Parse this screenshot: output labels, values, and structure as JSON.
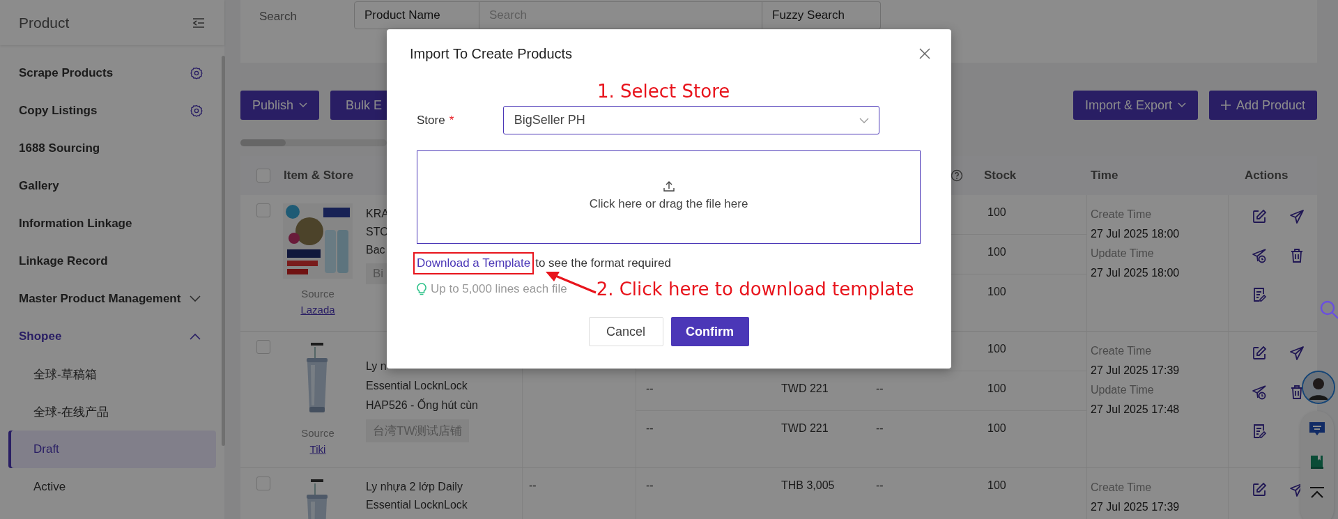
{
  "sidebar": {
    "title": "Product",
    "items": [
      {
        "label": "Scrape Products",
        "kind": "setting",
        "selected": false
      },
      {
        "label": "Copy Listings",
        "kind": "setting",
        "selected": false
      },
      {
        "label": "1688 Sourcing",
        "kind": "link",
        "selected": false
      },
      {
        "label": "Gallery",
        "kind": "link",
        "selected": false
      },
      {
        "label": "Information Linkage",
        "kind": "link",
        "selected": false
      },
      {
        "label": "Linkage Record",
        "kind": "link",
        "selected": false
      },
      {
        "label": "Master Product Management",
        "kind": "group",
        "selected": false,
        "expanded": false
      },
      {
        "label": "Shopee",
        "kind": "group",
        "selected": true,
        "expanded": true,
        "children": [
          {
            "label": "全球-草稿箱",
            "selected": false
          },
          {
            "label": "全球-在线产品",
            "selected": false
          },
          {
            "label": "Draft",
            "selected": true
          },
          {
            "label": "Active",
            "selected": false
          }
        ]
      }
    ]
  },
  "search": {
    "label": "Search",
    "field": "Product Name",
    "placeholder": "Search",
    "mode": "Fuzzy Search"
  },
  "toolbar": {
    "left": [
      {
        "label": "Publish",
        "kind": "menu"
      },
      {
        "label": "Bulk E",
        "kind": "plain"
      }
    ],
    "right": [
      {
        "label": "Import & Export",
        "kind": "menu"
      },
      {
        "label": "Add Product",
        "kind": "add"
      }
    ]
  },
  "table": {
    "select_all": {
      "checked": false
    },
    "headers": {
      "item": "Item & Store",
      "stock": "Stock",
      "time": "Time",
      "actions": "Actions"
    },
    "rows": [
      {
        "checked": false,
        "image": {
          "kind": "picture"
        },
        "title_lines": [
          "KRA",
          "STO",
          "Bac"
        ],
        "tag": "Bi",
        "source_label": "Source",
        "source": "Lazada",
        "variants": [
          {
            "stock": "100"
          },
          {
            "stock": "100"
          },
          {
            "stock": "100"
          }
        ],
        "times": [
          {
            "label": "Create Time",
            "value": "27 Jul 2025 18:00"
          },
          {
            "label": "Update Time",
            "value": "27 Jul 2025 18:00"
          }
        ],
        "actions": [
          {
            "kind": "edit"
          },
          {
            "kind": "publish"
          },
          {
            "kind": "schedule"
          },
          {
            "kind": "delete"
          },
          {
            "kind": "notes"
          }
        ]
      },
      {
        "checked": false,
        "image": {
          "kind": "picture"
        },
        "title_lines": [
          "Ly n",
          "Essential LocknLock",
          "HAP526 - Ống hút cùn"
        ],
        "tag": "台湾TW测试店铺",
        "source_label": "Source",
        "source": "Tiki",
        "variants": [
          {
            "stock": "100"
          },
          {
            "col_b": "--",
            "price": "TWD 221",
            "col_d": "--",
            "stock": "100"
          },
          {
            "col_b": "--",
            "price": "TWD 221",
            "col_d": "--",
            "stock": "100"
          }
        ],
        "times": [
          {
            "label": "Create Time",
            "value": "27 Jul 2025 17:39"
          },
          {
            "label": "Update Time",
            "value": "27 Jul 2025 17:48"
          }
        ],
        "actions": [
          {
            "kind": "edit"
          },
          {
            "kind": "publish"
          },
          {
            "kind": "schedule"
          },
          {
            "kind": "delete"
          },
          {
            "kind": "notes"
          }
        ]
      },
      {
        "checked": false,
        "image": {
          "kind": "picture"
        },
        "title_lines": [
          "Ly nhựa 2 lớp Daily",
          "Essential LocknLock"
        ],
        "col_a": "--",
        "variants": [
          {
            "col_b": "--",
            "price": "THB 3,005",
            "col_d": "--",
            "stock": "100"
          }
        ],
        "times": [
          {
            "label": "Create Time",
            "value": "27 Jul 2025 17:39"
          }
        ],
        "actions": [
          {
            "kind": "edit"
          },
          {
            "kind": "publish"
          }
        ]
      }
    ]
  },
  "modal": {
    "title": "Import To Create Products",
    "store_label": "Store",
    "required_mark": "*",
    "store_value": "BigSeller PH",
    "upload_text": "Click here or drag the file here",
    "template_link": "Download a Template",
    "template_rest": "to see the format required",
    "hint": "Up to 5,000 lines each file",
    "buttons": [
      {
        "label": "Cancel",
        "kind": "default"
      },
      {
        "label": "Confirm",
        "kind": "primary"
      }
    ]
  },
  "annotations": [
    {
      "text": "1. Select Store"
    },
    {
      "text": "2. Click here to download template"
    }
  ]
}
